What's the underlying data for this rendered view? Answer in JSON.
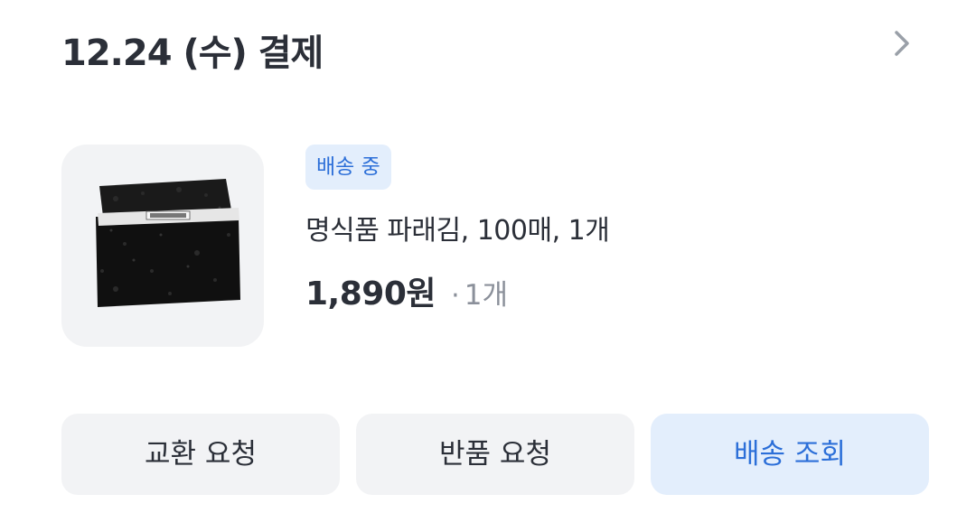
{
  "order": {
    "date_label": "12.24 (수) 결제",
    "chevron_icon": "chevron-right-icon"
  },
  "product": {
    "status_badge": "배송 중",
    "name": "명식품 파래김, 100매, 1개",
    "price": "1,890원",
    "quantity_separator": "·",
    "quantity": "1개",
    "thumbnail_icon": "seaweed-laver-product-image"
  },
  "actions": {
    "exchange_label": "교환 요청",
    "return_label": "반품 요청",
    "track_label": "배송 조회"
  },
  "colors": {
    "text": "#2b2f38",
    "muted": "#8b909a",
    "accent": "#2c6fd8",
    "accent_bg": "#e3eefc",
    "neutral_bg": "#f2f3f5"
  }
}
